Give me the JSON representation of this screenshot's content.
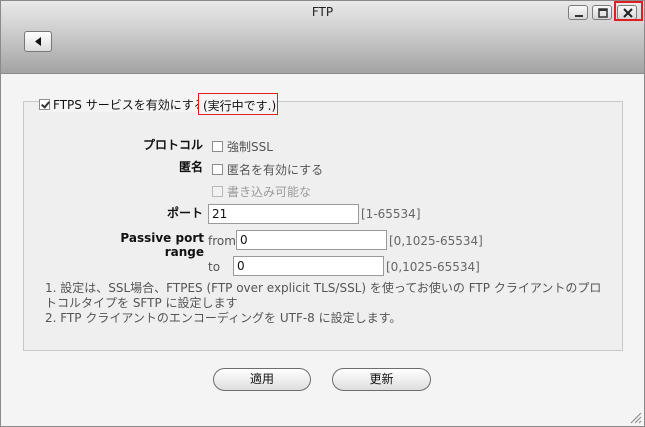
{
  "window": {
    "title": "FTP"
  },
  "ftps": {
    "enable_label": "FTPS サービスを有効にする",
    "status_text": "(実行中です.)",
    "enabled": true
  },
  "protocol": {
    "label": "プロトコル",
    "force_ssl_label": "強制SSL"
  },
  "anonymous": {
    "label": "匿名",
    "enable_label": "匿名を有効にする",
    "writable_label": "書き込み可能な"
  },
  "port": {
    "label": "ポート",
    "value": "21",
    "range": "[1-65534]"
  },
  "passive": {
    "label": "Passive port range",
    "from_label": "from",
    "from_value": "0",
    "from_range": "[0,1025-65534]",
    "to_label": "to",
    "to_value": "0",
    "to_range": "[0,1025-65534]"
  },
  "notes": {
    "line1": "1. 設定は、SSL場合、FTPES (FTP over explicit TLS/SSL) を使ってお使いの FTP クライアントのプロトコルタイプを SFTP に設定します",
    "line2": "2. FTP クライアントのエンコーディングを UTF-8 に設定します。"
  },
  "buttons": {
    "apply": "適用",
    "refresh": "更新"
  },
  "colors": {
    "highlight": "#e02020",
    "titlebar_top": "#e9e9e9",
    "titlebar_bottom": "#a3a3a3"
  },
  "icons": [
    "minimize-icon",
    "maximize-icon",
    "close-icon",
    "back-arrow-icon",
    "checkbox-checked-icon",
    "resize-grip-icon"
  ]
}
